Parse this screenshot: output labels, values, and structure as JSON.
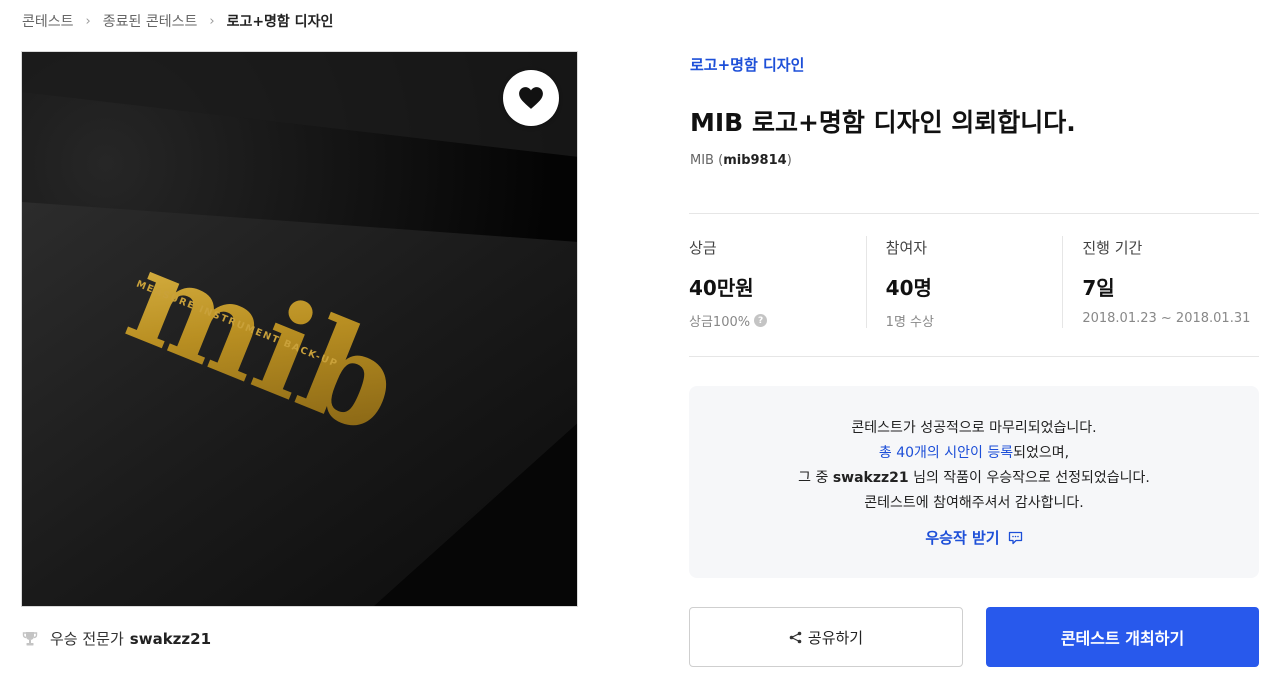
{
  "breadcrumb": [
    "콘테스트",
    "종료된 콘테스트",
    "로고+명함 디자인"
  ],
  "contest": {
    "category": "로고+명함 디자인",
    "title": "MIB 로고+명함 디자인 의뢰합니다.",
    "host_name": "MIB",
    "host_id": "mib9814"
  },
  "hero": {
    "logo_text": "mib",
    "tagline": "MEASURE INSTRUMENT BACK-UP",
    "like_icon": "heart-icon"
  },
  "winner": {
    "label": "우승 전문가",
    "name": "swakzz21",
    "icon": "trophy-icon"
  },
  "stats": {
    "prize": {
      "label": "상금",
      "value": "40만원",
      "sub": "상금100%"
    },
    "participants": {
      "label": "참여자",
      "value": "40명",
      "sub": "1명 수상"
    },
    "period": {
      "label": "진행 기간",
      "value": "7일",
      "sub": "2018.01.23 ~ 2018.01.31"
    }
  },
  "result": {
    "line1": "콘테스트가 성공적으로 마무리되었습니다.",
    "line2_highlight": "총 40개의 시안이 등록",
    "line2_rest": "되었으며,",
    "line3_pre": "그 중 ",
    "line3_name": "swakzz21",
    "line3_post": " 님의 작품이 우승작으로 선정되었습니다.",
    "line4": "콘테스트에 참여해주셔서 감사합니다.",
    "receive_label": "우승작 받기"
  },
  "actions": {
    "share_label": "공유하기",
    "host_label": "콘테스트 개최하기"
  },
  "colors": {
    "accent": "#2859ec",
    "link": "#1d4fd8",
    "gold": "#b8922a"
  }
}
